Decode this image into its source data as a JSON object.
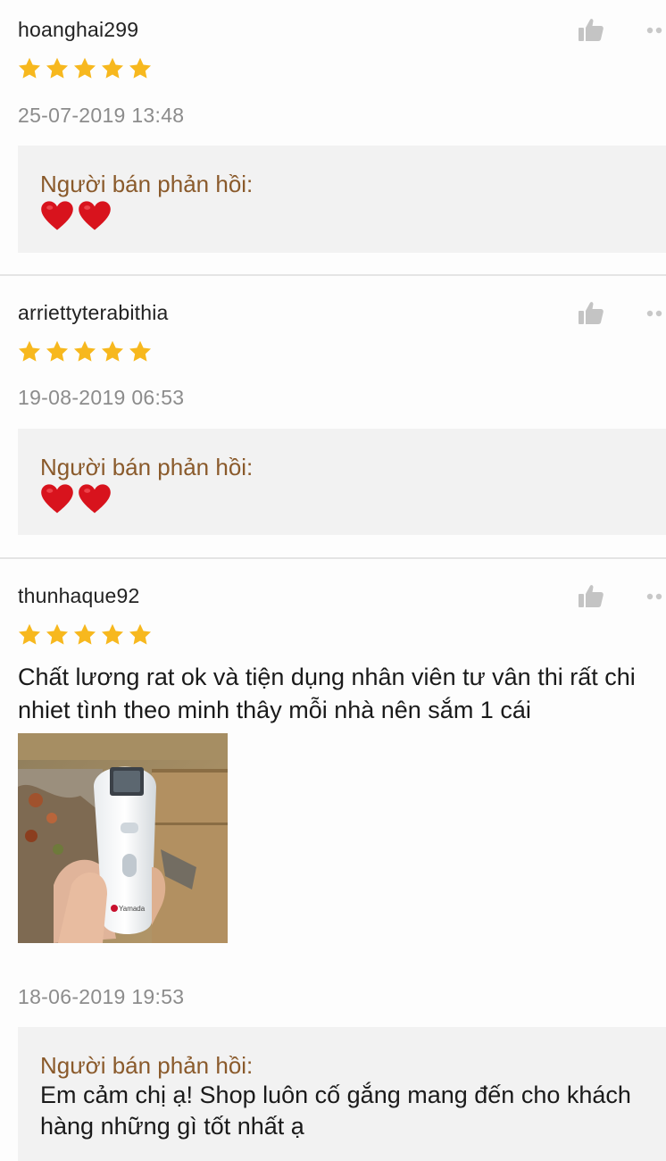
{
  "reviews": [
    {
      "username": "hoanghai299",
      "rating": 5,
      "date": "25-07-2019 13:48",
      "reply_label": "Người bán phản hồi:",
      "reply_hearts": 2
    },
    {
      "username": "arriettyterabithia",
      "rating": 5,
      "date": "19-08-2019 06:53",
      "reply_label": "Người bán phản hồi:",
      "reply_hearts": 2
    },
    {
      "username": "thunhaque92",
      "rating": 5,
      "comment": "Chất lương rat ok và tiện dụng nhân viên tư vân thi rất chi nhiet tình theo minh thây mỗi nhà nên sắm 1 cái",
      "photo_brand": "Yamada",
      "date": "18-06-2019 19:53",
      "reply_label": "Người bán phản hồi:",
      "reply_text": "Em cảm chị ạ! Shop luôn cố gắng mang đến cho khách hàng những gì tốt nhất ạ"
    }
  ],
  "icons": {
    "like": "thumbs-up-icon",
    "more": "more-dots-icon",
    "star": "star-icon",
    "heart": "heart-icon"
  },
  "colors": {
    "star": "#f7b81e",
    "heart": "#d8131d",
    "reply_label": "#8a5a2b",
    "date": "#8c8c8c",
    "reply_bg": "#f2f2f2"
  }
}
